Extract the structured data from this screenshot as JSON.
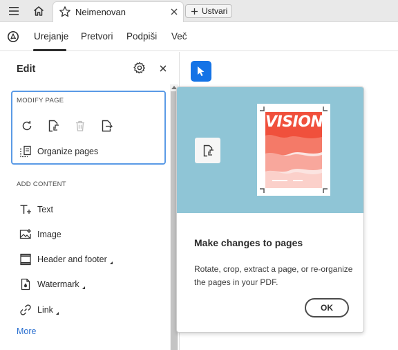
{
  "tabbar": {
    "menu_icon": "hamburger-menu-icon",
    "home_icon": "home-icon",
    "doc_tab": {
      "title": "Neimenovan",
      "star_icon": "star-icon",
      "close_icon": "close-icon"
    },
    "create_button": {
      "label": "Ustvari",
      "icon": "plus-icon"
    }
  },
  "menubar": {
    "app_icon": "acrobat-logo-icon",
    "items": [
      {
        "label": "Urejanje",
        "active": true
      },
      {
        "label": "Pretvori",
        "active": false
      },
      {
        "label": "Podpiši",
        "active": false
      },
      {
        "label": "Več",
        "active": false
      }
    ]
  },
  "panel": {
    "title": "Edit",
    "settings_icon": "gear-icon",
    "close_icon": "close-icon",
    "modify_page": {
      "heading": "MODIFY PAGE",
      "tools": [
        "rotate-icon",
        "crop-page-icon",
        "delete-page-icon",
        "extract-page-icon"
      ],
      "organize_label": "Organize pages"
    },
    "add_content": {
      "heading": "ADD CONTENT",
      "items": [
        {
          "label": "Text",
          "icon": "add-text-icon",
          "has_submenu": false
        },
        {
          "label": "Image",
          "icon": "add-image-icon",
          "has_submenu": false
        },
        {
          "label": "Header and footer",
          "icon": "header-footer-icon",
          "has_submenu": true
        },
        {
          "label": "Watermark",
          "icon": "watermark-icon",
          "has_submenu": true
        },
        {
          "label": "Link",
          "icon": "link-icon",
          "has_submenu": true
        }
      ]
    },
    "more_label": "More"
  },
  "canvas": {
    "select_tool_icon": "cursor-arrow-icon"
  },
  "popover": {
    "banner_color": "#8fc5d6",
    "banner_icon": "crop-page-icon",
    "illustration_word": "VISION",
    "title": "Make changes to pages",
    "body": "Rotate, crop, extract a page, or re-organize the pages in your PDF.",
    "ok_label": "OK"
  },
  "colors": {
    "accent": "#1473e6",
    "focus_ring": "#5a9ae6",
    "link": "#2a6fd0"
  }
}
